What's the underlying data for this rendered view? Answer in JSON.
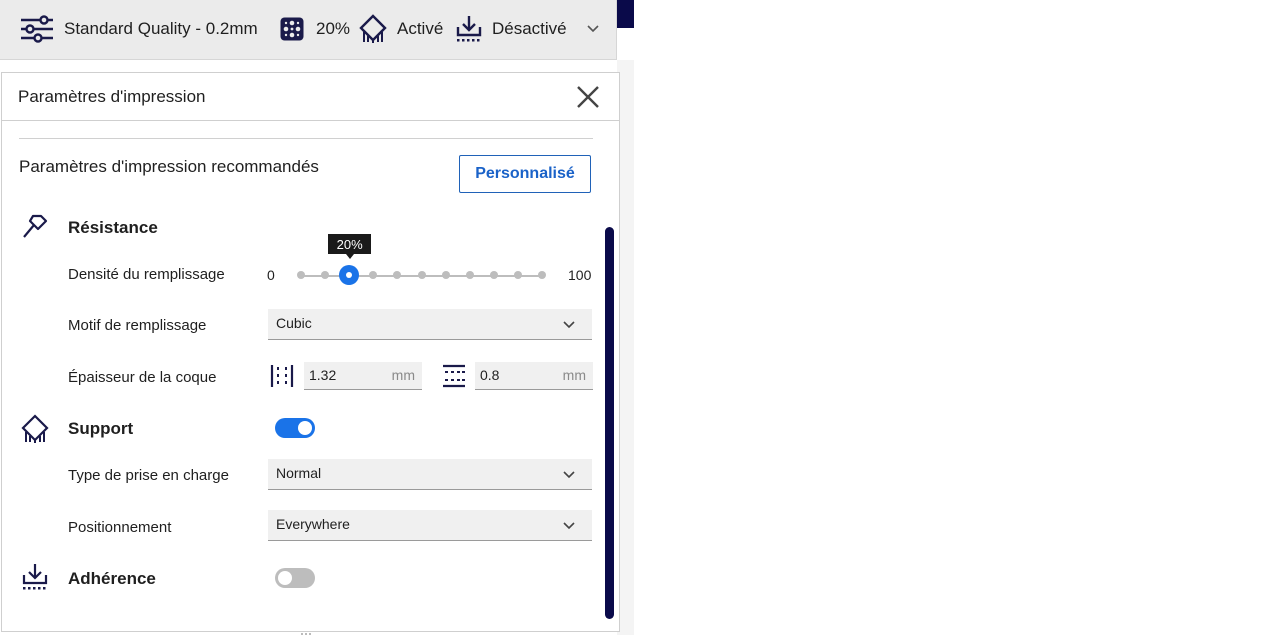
{
  "header": {
    "profile_label": "Standard Quality - 0.2mm",
    "infill_label": "20%",
    "support_label": "Activé",
    "adhesion_label": "Désactivé",
    "icons": {
      "profile": "sliders-icon",
      "infill": "infill-icon",
      "support": "support-icon",
      "adhesion": "adhesion-icon",
      "expand": "chevron-down-icon"
    }
  },
  "panel": {
    "title": "Paramètres d'impression",
    "recommended_label": "Paramètres d'impression recommandés",
    "custom_button": "Personnalisé"
  },
  "resistance": {
    "title": "Résistance",
    "infill_density": {
      "label": "Densité du remplissage",
      "min": "0",
      "max": "100",
      "value": 20,
      "tooltip": "20%"
    },
    "infill_pattern": {
      "label": "Motif de remplissage",
      "value": "Cubic"
    },
    "shell_thickness": {
      "label": "Épaisseur de la coque",
      "wall_value": "1.32",
      "wall_unit": "mm",
      "topbottom_value": "0.8",
      "topbottom_unit": "mm"
    }
  },
  "support": {
    "title": "Support",
    "enabled": true,
    "type": {
      "label": "Type de prise en charge",
      "value": "Normal"
    },
    "placement": {
      "label": "Positionnement",
      "value": "Everywhere"
    }
  },
  "adhesion": {
    "title": "Adhérence",
    "enabled": false
  },
  "colors": {
    "accent": "#1a73e8",
    "dark_navy": "#0a0a4a",
    "header_bg": "#ebebeb",
    "toggle_off": "#bdbdbd"
  }
}
